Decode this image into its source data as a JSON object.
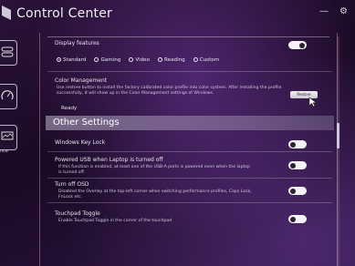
{
  "header": {
    "title": "Control Center",
    "minimize": "—",
    "settings": "⚙"
  },
  "sidebar": {
    "label": "nce"
  },
  "display_features": {
    "heading": "Display features",
    "options": [
      "Standard",
      "Gaming",
      "Video",
      "Reading",
      "Custom"
    ],
    "selected": "Standard"
  },
  "color_management": {
    "heading": "Color Management",
    "description": "Use restore button to install the factory calibrated color profile into color system. After installing the profile successfully, it will show up in the Color Management settings of Windows.",
    "status": "Ready",
    "button": "Restore"
  },
  "other_settings": {
    "title": "Other Settings",
    "items": [
      {
        "heading": "Windows Key Lock",
        "description": "",
        "state": "off"
      },
      {
        "heading": "Powered USB when Laptop is turned off",
        "description": "If this function is enabled, at least one of the USB-A ports is powered even when the laptop is turned off.",
        "state": "off"
      },
      {
        "heading": "Turn off OSD",
        "description": "Disabled the Overlay at the top-left corner when switching performance profiles, Caps Lock, FnLock etc.",
        "state": "off"
      },
      {
        "heading": "Touchpad Toggle",
        "description": "Enable Touchpad Toggle in the corner of the touchpad",
        "state": "off"
      }
    ]
  }
}
